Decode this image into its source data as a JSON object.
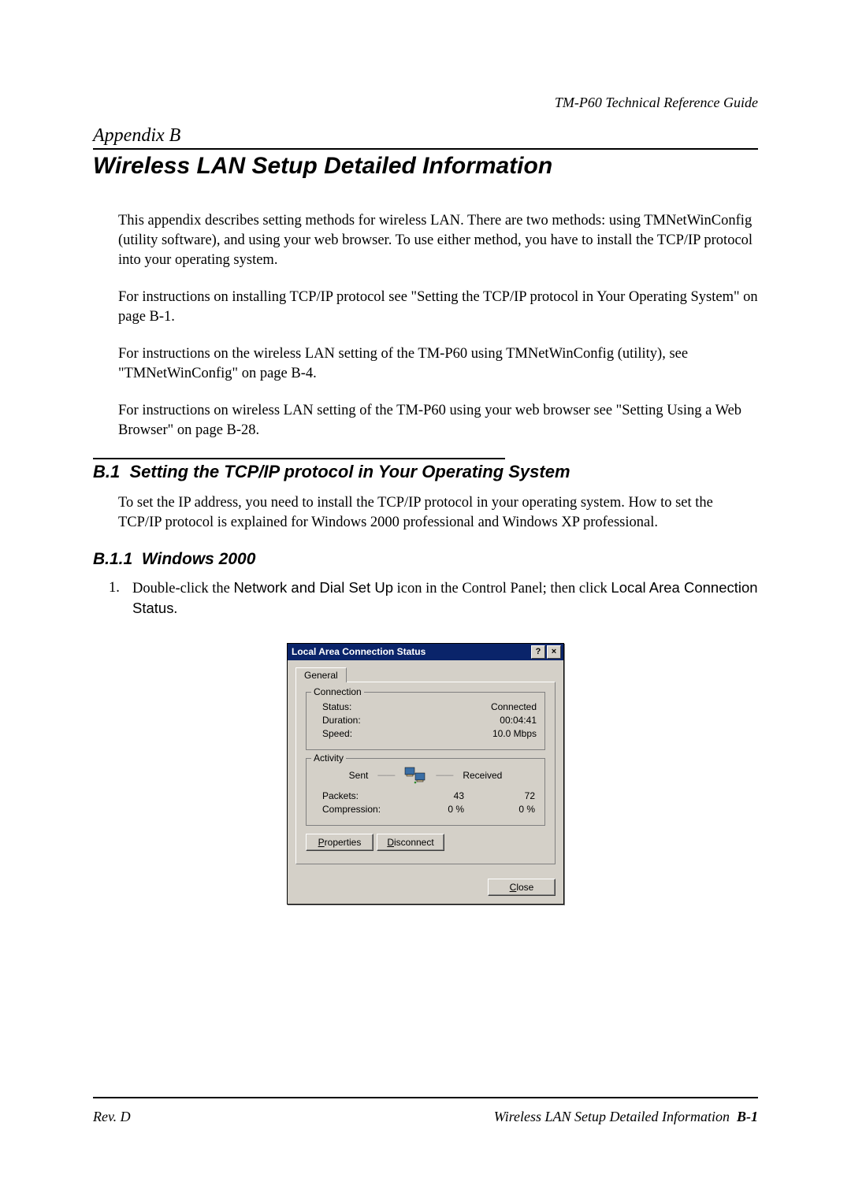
{
  "header": {
    "guide_title": "TM-P60 Technical Reference Guide"
  },
  "appendix": {
    "label": "Appendix B"
  },
  "title": "Wireless LAN Setup Detailed Information",
  "intro": [
    "This appendix describes setting methods for wireless LAN. There are two methods: using TMNetWinConfig (utility software), and using your web browser. To use either method, you have to install the TCP/IP protocol into your operating system.",
    "For instructions on installing TCP/IP protocol see \"Setting the TCP/IP protocol in Your Operating System\" on page B-1.",
    "For instructions on the wireless LAN setting of the TM-P60 using TMNetWinConfig (utility), see \"TMNetWinConfig\" on page B-4.",
    "For instructions on wireless LAN setting of the TM-P60 using your web browser see \"Setting Using a Web Browser\" on page B-28."
  ],
  "section": {
    "number": "B.1",
    "title": "Setting the TCP/IP protocol in Your Operating System",
    "body": "To set the IP address, you need to install the TCP/IP protocol in your operating system. How to set the TCP/IP protocol is explained for  Windows 2000 professional and Windows XP professional."
  },
  "subsection": {
    "number": "B.1.1",
    "title": "Windows 2000"
  },
  "step": {
    "num": "1.",
    "prefix": "Double-click the ",
    "span1": "Network and Dial Set Up",
    "mid": " icon in the Control Panel; then click ",
    "span2": "Local Area Connection Status",
    "suffix": "."
  },
  "dialog": {
    "title": "Local Area Connection Status",
    "help": "?",
    "close_x": "×",
    "tab": "General",
    "connection": {
      "legend": "Connection",
      "status_label": "Status:",
      "status_value": "Connected",
      "duration_label": "Duration:",
      "duration_value": "00:04:41",
      "speed_label": "Speed:",
      "speed_value": "10.0 Mbps"
    },
    "activity": {
      "legend": "Activity",
      "sent": "Sent",
      "received": "Received",
      "packets_label": "Packets:",
      "packets_sent": "43",
      "packets_received": "72",
      "compression_label": "Compression:",
      "compression_sent": "0 %",
      "compression_received": "0 %"
    },
    "buttons": {
      "properties": "Properties",
      "disconnect": "Disconnect",
      "close": "Close"
    }
  },
  "footer": {
    "rev": "Rev. D",
    "title": "Wireless LAN Setup Detailed Information",
    "page": "B-1"
  }
}
